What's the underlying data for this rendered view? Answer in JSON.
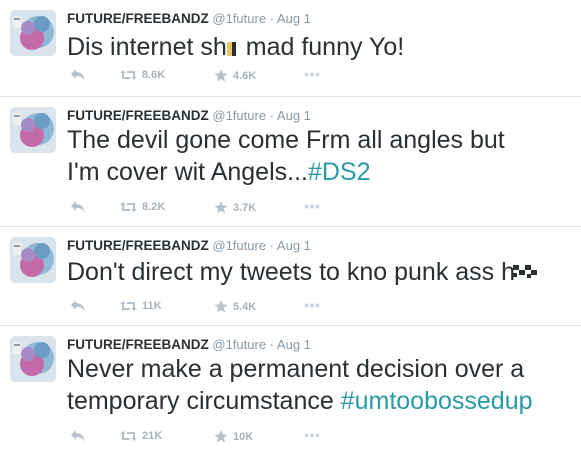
{
  "tweets": [
    {
      "name": "FUTURE/FREEBANDZ",
      "handle": "@1future",
      "sep": "·",
      "time": "Aug 1",
      "text_a": "Dis internet sh",
      "text_b": " mad funny Yo!",
      "hashtag": "",
      "retweets": "8.6K",
      "favorites": "4.6K"
    },
    {
      "name": "FUTURE/FREEBANDZ",
      "handle": "@1future",
      "sep": "·",
      "time": "Aug 1",
      "line1": "The devil gone come Frm all angles but",
      "line2": "I'm cover wit Angels...",
      "hashtag": "#DS2",
      "retweets": "8.2K",
      "favorites": "3.7K"
    },
    {
      "name": "FUTURE/FREEBANDZ",
      "handle": "@1future",
      "sep": "·",
      "time": "Aug 1",
      "line1": "Don't direct my tweets to kno punk ass h",
      "hashtag": "",
      "retweets": "11K",
      "favorites": "5.4K"
    },
    {
      "name": "FUTURE/FREEBANDZ",
      "handle": "@1future",
      "sep": "·",
      "time": "Aug 1",
      "line1": "Never make a permanent decision over a",
      "line2": "temporary circumstance ",
      "hashtag": "#umtoobossedup",
      "retweets": "21K",
      "favorites": "10K"
    }
  ],
  "icons": {
    "reply": "reply-icon",
    "retweet": "retweet-icon",
    "favorite": "star-icon",
    "more": "more-icon"
  },
  "colors": {
    "hashtag": "#2a9aa5",
    "muted": "#8899a6",
    "icon": "#b8c2cc"
  }
}
